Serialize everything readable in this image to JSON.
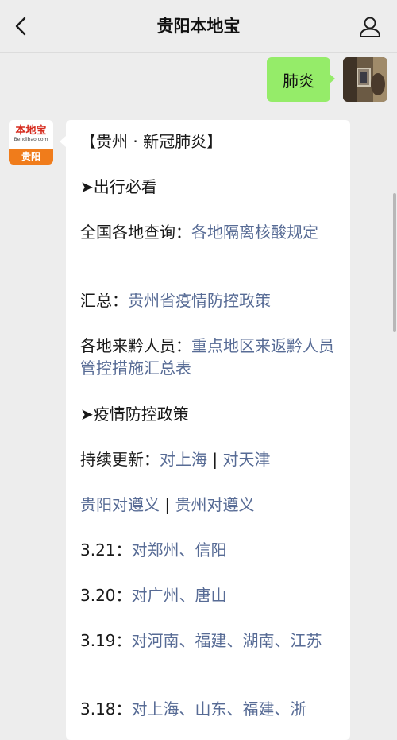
{
  "header": {
    "title": "贵阳本地宝"
  },
  "outgoing": {
    "text": "肺炎"
  },
  "incoming_avatar": {
    "logo_main": "本地宝",
    "logo_sub": "Bendibao.com",
    "logo_city": "贵阳"
  },
  "message": {
    "heading": "【贵州 · 新冠肺炎】",
    "section1": "➤出行必看",
    "row1": {
      "label": "全国各地查询：",
      "link": "各地隔离核酸规定"
    },
    "row2": {
      "label": "汇总：",
      "link": "贵州省疫情防控政策"
    },
    "row3": {
      "label": "各地来黔人员：",
      "link": "重点地区来返黔人员管控措施汇总表"
    },
    "section2": "➤疫情防控政策",
    "row4": {
      "label": "持续更新：",
      "link1": "对上海",
      "sep": " | ",
      "link2": "对天津"
    },
    "row5": {
      "link1": "贵阳对遵义",
      "sep": " | ",
      "link2": "贵州对遵义"
    },
    "row6": {
      "label": "3.21：",
      "link": "对郑州、信阳"
    },
    "row7": {
      "label": "3.20：",
      "link": "对广州、唐山"
    },
    "row8": {
      "label": "3.19：",
      "link": "对河南、福建、湖南、江苏"
    },
    "row9": {
      "label": "3.18：",
      "link": "对上海、山东、福建、浙"
    }
  },
  "colors": {
    "link": "#576b95",
    "outgoing_bubble": "#95ec69",
    "logo_orange": "#f07c1b",
    "logo_red": "#d62b1e"
  }
}
